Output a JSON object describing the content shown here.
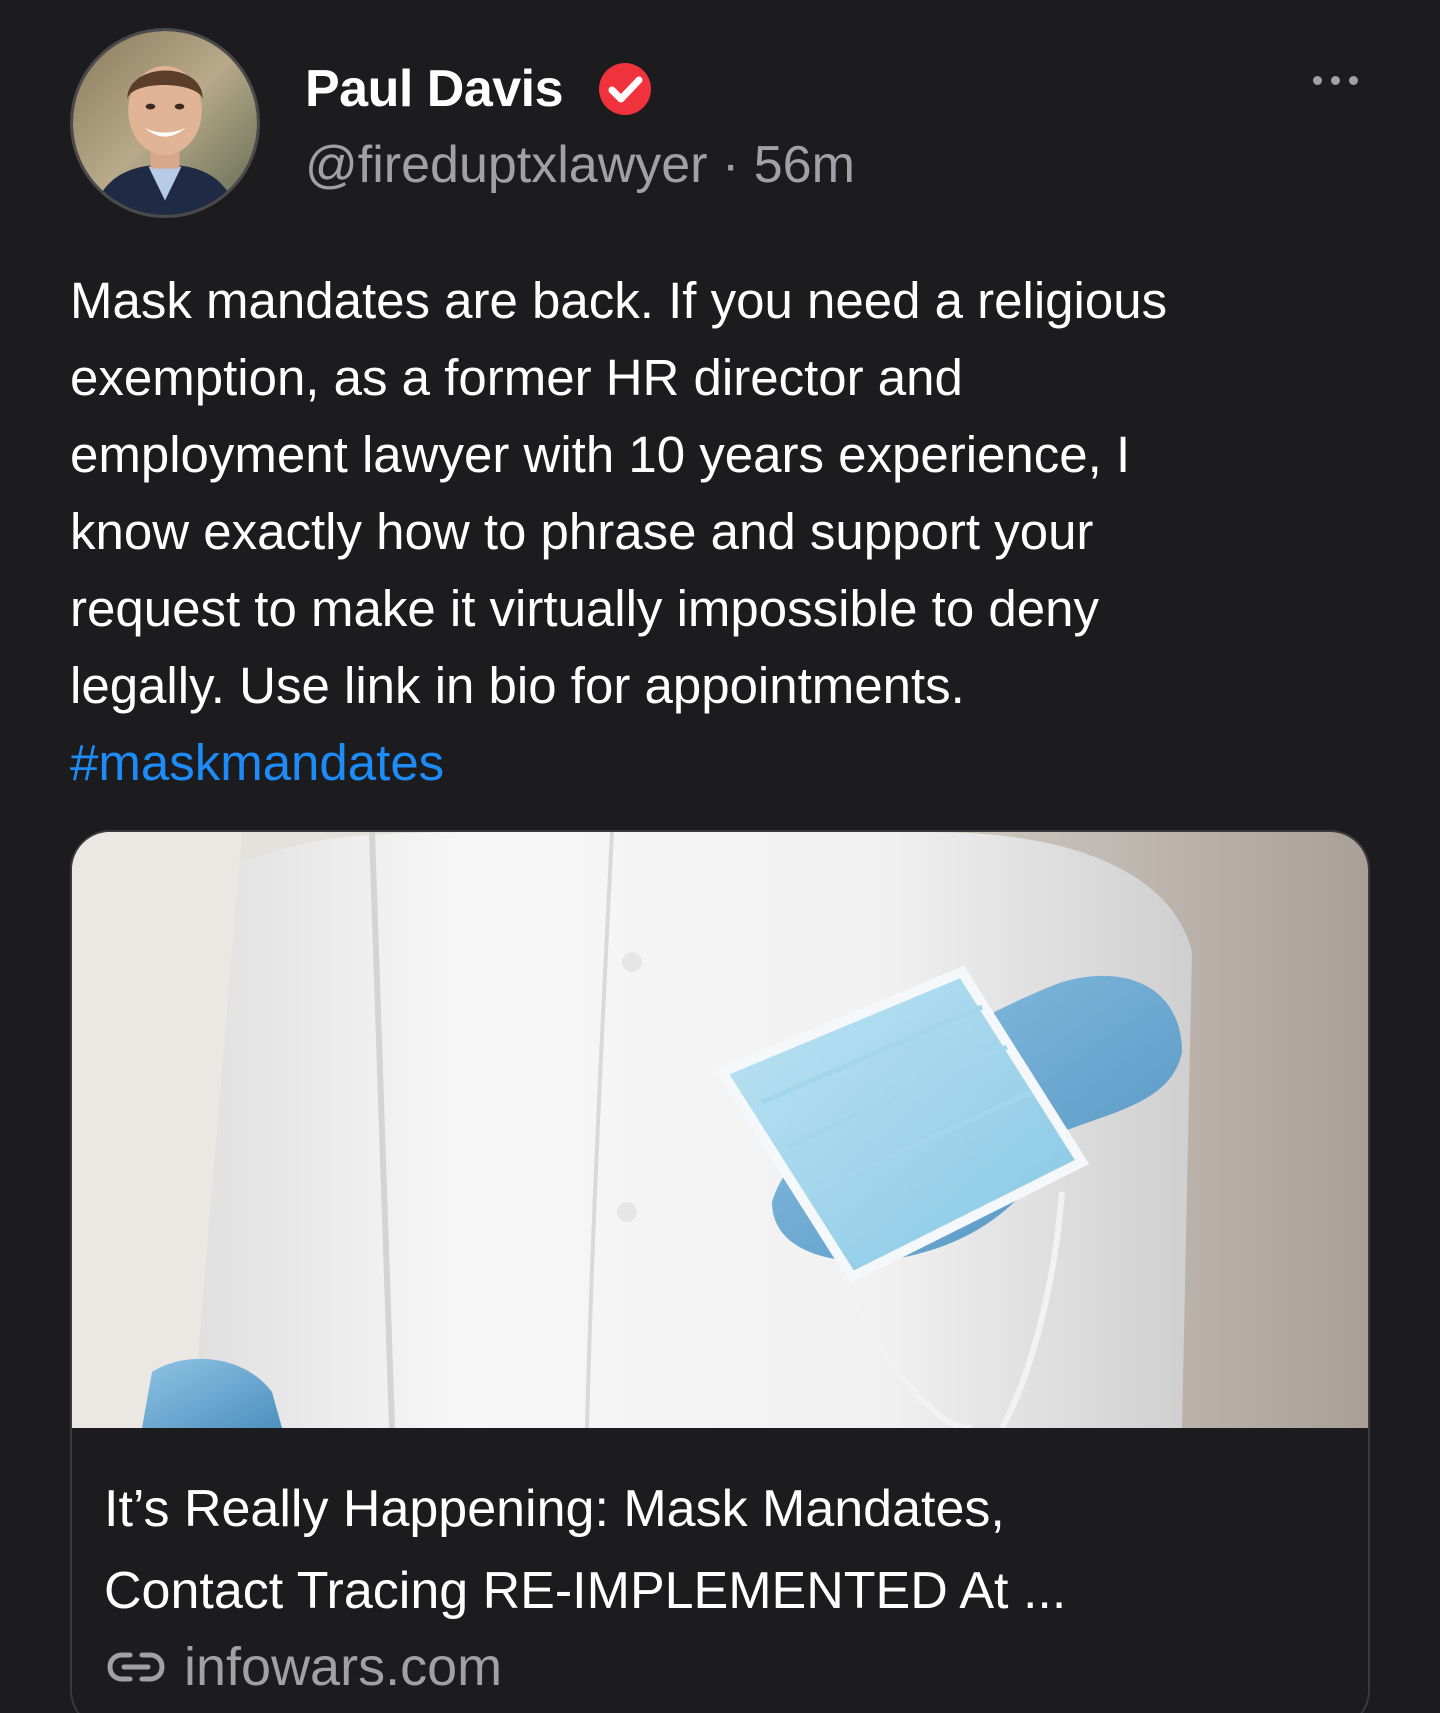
{
  "post": {
    "author": {
      "display_name": "Paul Davis",
      "verified": true,
      "handle": "@fireduptxlawyer",
      "separator": "·",
      "timestamp": "56m"
    },
    "body_lines": [
      "Mask mandates are back. If you need a religious",
      "exemption, as a former HR director and",
      "employment lawyer with 10 years experience, I",
      "know exactly how to phrase and support your",
      "request to make it virtually impossible to deny",
      "legally. Use link in bio for appointments."
    ],
    "hashtag": "#maskmandates",
    "link_card": {
      "title_lines": [
        "It’s Really Happening: Mask Mandates,",
        "Contact Tracing RE-IMPLEMENTED At ..."
      ],
      "domain": "infowars.com"
    }
  },
  "colors": {
    "background": "#1c1c1e",
    "text": "#ffffff",
    "secondary_text": "#a0a0a6",
    "hashtag": "#1d8cf8",
    "verified_badge": "#f0323c"
  },
  "icons": {
    "verified": "verified-check-icon",
    "more": "more-horizontal-icon",
    "link": "link-icon"
  }
}
